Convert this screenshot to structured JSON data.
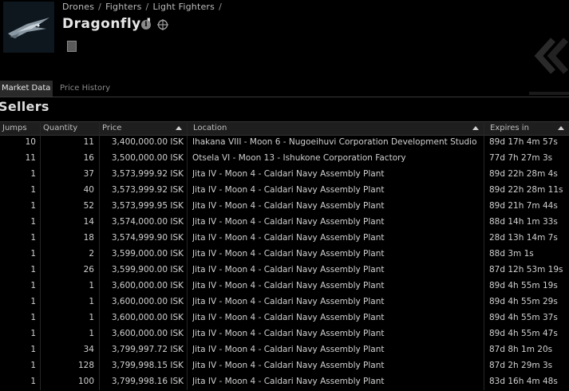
{
  "header": {
    "breadcrumb": [
      "Drones",
      "Fighters",
      "Light Fighters"
    ],
    "breadcrumb_trailing_sep": "/",
    "title": "Dragonfly I",
    "info_icon_glyph": "i"
  },
  "tabs": [
    {
      "label": "Market Data",
      "active": true
    },
    {
      "label": "Price History",
      "active": false
    }
  ],
  "section_title": "Sellers",
  "columns": [
    {
      "label": "Jumps"
    },
    {
      "label": "Quantity"
    },
    {
      "label": "Price"
    },
    {
      "label": "Location"
    },
    {
      "label": "Expires in"
    }
  ],
  "rows": [
    {
      "jumps": "10",
      "qty": "11",
      "price": "3,400,000.00 ISK",
      "loc": "Ihakana VIII - Moon 6 - Nugoeihuvi Corporation Development Studio",
      "exp": "89d 17h 4m 57s"
    },
    {
      "jumps": "11",
      "qty": "16",
      "price": "3,500,000.00 ISK",
      "loc": "Otsela VI - Moon 13 - Ishukone Corporation Factory",
      "exp": "77d 7h 27m 3s"
    },
    {
      "jumps": "1",
      "qty": "37",
      "price": "3,573,999.92 ISK",
      "loc": "Jita IV - Moon 4 - Caldari Navy Assembly Plant",
      "exp": "89d 22h 28m 4s"
    },
    {
      "jumps": "1",
      "qty": "40",
      "price": "3,573,999.92 ISK",
      "loc": "Jita IV - Moon 4 - Caldari Navy Assembly Plant",
      "exp": "89d 22h 28m 11s"
    },
    {
      "jumps": "1",
      "qty": "52",
      "price": "3,573,999.95 ISK",
      "loc": "Jita IV - Moon 4 - Caldari Navy Assembly Plant",
      "exp": "89d 21h 7m 44s"
    },
    {
      "jumps": "1",
      "qty": "14",
      "price": "3,574,000.00 ISK",
      "loc": "Jita IV - Moon 4 - Caldari Navy Assembly Plant",
      "exp": "88d 14h 1m 33s"
    },
    {
      "jumps": "1",
      "qty": "18",
      "price": "3,574,999.90 ISK",
      "loc": "Jita IV - Moon 4 - Caldari Navy Assembly Plant",
      "exp": "28d 13h 14m 7s"
    },
    {
      "jumps": "1",
      "qty": "2",
      "price": "3,599,000.00 ISK",
      "loc": "Jita IV - Moon 4 - Caldari Navy Assembly Plant",
      "exp": "88d 3m 1s"
    },
    {
      "jumps": "1",
      "qty": "26",
      "price": "3,599,900.00 ISK",
      "loc": "Jita IV - Moon 4 - Caldari Navy Assembly Plant",
      "exp": "87d 12h 53m 19s"
    },
    {
      "jumps": "1",
      "qty": "1",
      "price": "3,600,000.00 ISK",
      "loc": "Jita IV - Moon 4 - Caldari Navy Assembly Plant",
      "exp": "89d 4h 55m 19s"
    },
    {
      "jumps": "1",
      "qty": "1",
      "price": "3,600,000.00 ISK",
      "loc": "Jita IV - Moon 4 - Caldari Navy Assembly Plant",
      "exp": "89d 4h 55m 29s"
    },
    {
      "jumps": "1",
      "qty": "1",
      "price": "3,600,000.00 ISK",
      "loc": "Jita IV - Moon 4 - Caldari Navy Assembly Plant",
      "exp": "89d 4h 55m 37s"
    },
    {
      "jumps": "1",
      "qty": "1",
      "price": "3,600,000.00 ISK",
      "loc": "Jita IV - Moon 4 - Caldari Navy Assembly Plant",
      "exp": "89d 4h 55m 47s"
    },
    {
      "jumps": "1",
      "qty": "34",
      "price": "3,799,997.72 ISK",
      "loc": "Jita IV - Moon 4 - Caldari Navy Assembly Plant",
      "exp": "87d 8h 1m 20s"
    },
    {
      "jumps": "1",
      "qty": "128",
      "price": "3,799,998.15 ISK",
      "loc": "Jita IV - Moon 4 - Caldari Navy Assembly Plant",
      "exp": "87d 2h 29m 3s"
    },
    {
      "jumps": "1",
      "qty": "100",
      "price": "3,799,998.16 ISK",
      "loc": "Jita IV - Moon 4 - Caldari Navy Assembly Plant",
      "exp": "83d 16h 4m 48s"
    }
  ]
}
